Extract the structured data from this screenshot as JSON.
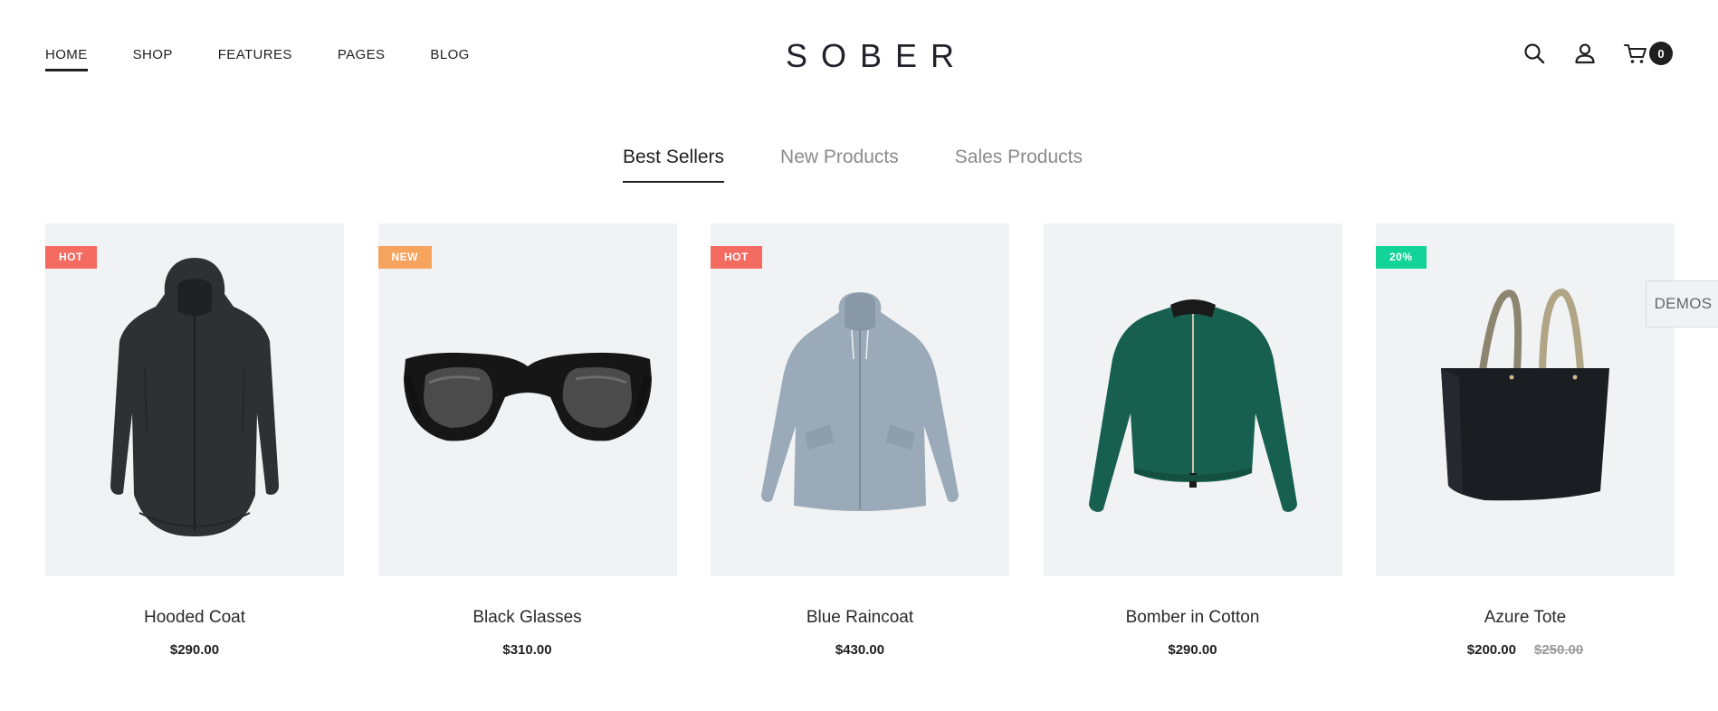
{
  "header": {
    "nav": [
      {
        "label": "HOME",
        "active": true
      },
      {
        "label": "SHOP",
        "active": false
      },
      {
        "label": "FEATURES",
        "active": false
      },
      {
        "label": "PAGES",
        "active": false
      },
      {
        "label": "BLOG",
        "active": false
      }
    ],
    "logo": "SOBER",
    "icons": [
      "search-icon",
      "user-icon",
      "cart-icon"
    ],
    "cart_count": "0"
  },
  "tabs": [
    {
      "label": "Best Sellers",
      "active": true
    },
    {
      "label": "New Products",
      "active": false
    },
    {
      "label": "Sales Products",
      "active": false
    }
  ],
  "products": [
    {
      "name": "Hooded Coat",
      "price": "$290.00",
      "badge": "HOT",
      "badge_color": "#f46b61"
    },
    {
      "name": "Black Glasses",
      "price": "$310.00",
      "badge": "NEW",
      "badge_color": "#f6a35e"
    },
    {
      "name": "Blue Raincoat",
      "price": "$430.00",
      "badge": "HOT",
      "badge_color": "#f46b61"
    },
    {
      "name": "Bomber in Cotton",
      "price": "$290.00",
      "badge": "",
      "badge_color": ""
    },
    {
      "name": "Azure Tote",
      "price": "$200.00",
      "old_price": "$250.00",
      "badge": "20%",
      "badge_color": "#13d498"
    }
  ],
  "demos_label": "DEMOS",
  "colors": {
    "text": "#1f1f1f",
    "muted": "#8a8a8a",
    "card_bg": "#f1f2f4",
    "hot": "#f46b61",
    "new": "#f6a35e",
    "sale": "#13d498"
  }
}
